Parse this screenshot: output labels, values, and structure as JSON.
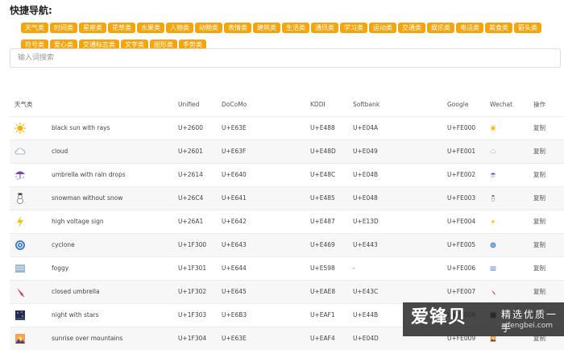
{
  "nav": {
    "title": "快捷导航:",
    "tags": [
      "天气类",
      "时间类",
      "星座类",
      "花草类",
      "水果类",
      "人物类",
      "动物类",
      "表情类",
      "建筑类",
      "生活类",
      "通讯类",
      "学习类",
      "运动类",
      "交通类",
      "娱乐类",
      "电话类",
      "美食类",
      "箭头类",
      "符号类",
      "爱心类",
      "交通标志类",
      "文字类",
      "图形类",
      "手势类"
    ]
  },
  "search": {
    "placeholder": "输入词搜索"
  },
  "table": {
    "headers": [
      "天气类",
      "",
      "Unified",
      "DoCoMo",
      "KDDI",
      "Softbank",
      "Google",
      "Wechat",
      "操作"
    ],
    "rows": [
      {
        "icon": "sun-icon",
        "name": "black sun with rays",
        "unified": "U+2600",
        "docomo": "U+E63E",
        "kddi": "U+E488",
        "softbank": "U+E04A",
        "google": "U+FE000",
        "action": "复制"
      },
      {
        "icon": "cloud-icon",
        "name": "cloud",
        "unified": "U+2601",
        "docomo": "U+E63F",
        "kddi": "U+E48D",
        "softbank": "U+E049",
        "google": "U+FE001",
        "action": "复制"
      },
      {
        "icon": "umbrella-rain-icon",
        "name": "umbrella with rain drops",
        "unified": "U+2614",
        "docomo": "U+E640",
        "kddi": "U+E48C",
        "softbank": "U+E04B",
        "google": "U+FE002",
        "action": "复制"
      },
      {
        "icon": "snowman-icon",
        "name": "snowman without snow",
        "unified": "U+26C4",
        "docomo": "U+E641",
        "kddi": "U+E485",
        "softbank": "U+E048",
        "google": "U+FE003",
        "action": "复制"
      },
      {
        "icon": "high-voltage-icon",
        "name": "high voltage sign",
        "unified": "U+26A1",
        "docomo": "U+E642",
        "kddi": "U+E487",
        "softbank": "U+E13D",
        "google": "U+FE004",
        "action": "复制"
      },
      {
        "icon": "cyclone-icon",
        "name": "cyclone",
        "unified": "U+1F300",
        "docomo": "U+E643",
        "kddi": "U+E469",
        "softbank": "U+E443",
        "google": "U+FE005",
        "action": "复制"
      },
      {
        "icon": "foggy-icon",
        "name": "foggy",
        "unified": "U+1F301",
        "docomo": "U+E644",
        "kddi": "U+E598",
        "softbank": "-",
        "google": "U+FE006",
        "action": "复制"
      },
      {
        "icon": "closed-umbrella-icon",
        "name": "closed umbrella",
        "unified": "U+1F302",
        "docomo": "U+E645",
        "kddi": "U+EAE8",
        "softbank": "U+E43C",
        "google": "U+FE007",
        "action": "复制"
      },
      {
        "icon": "night-stars-icon",
        "name": "night with stars",
        "unified": "U+1F303",
        "docomo": "U+E6B3",
        "kddi": "U+EAF1",
        "softbank": "U+E44B",
        "google": "U+FE008",
        "action": "复制"
      },
      {
        "icon": "sunrise-mountains-icon",
        "name": "sunrise over mountains",
        "unified": "U+1F304",
        "docomo": "U+E63E",
        "kddi": "U+EAF4",
        "softbank": "U+E04D",
        "google": "U+FE009",
        "action": "复制"
      }
    ]
  },
  "watermark": {
    "main": "爱锋贝",
    "sub1": "精选优质一手",
    "sub2": "aifengbei.com"
  },
  "colors": {
    "tag": "#f5a50c"
  }
}
